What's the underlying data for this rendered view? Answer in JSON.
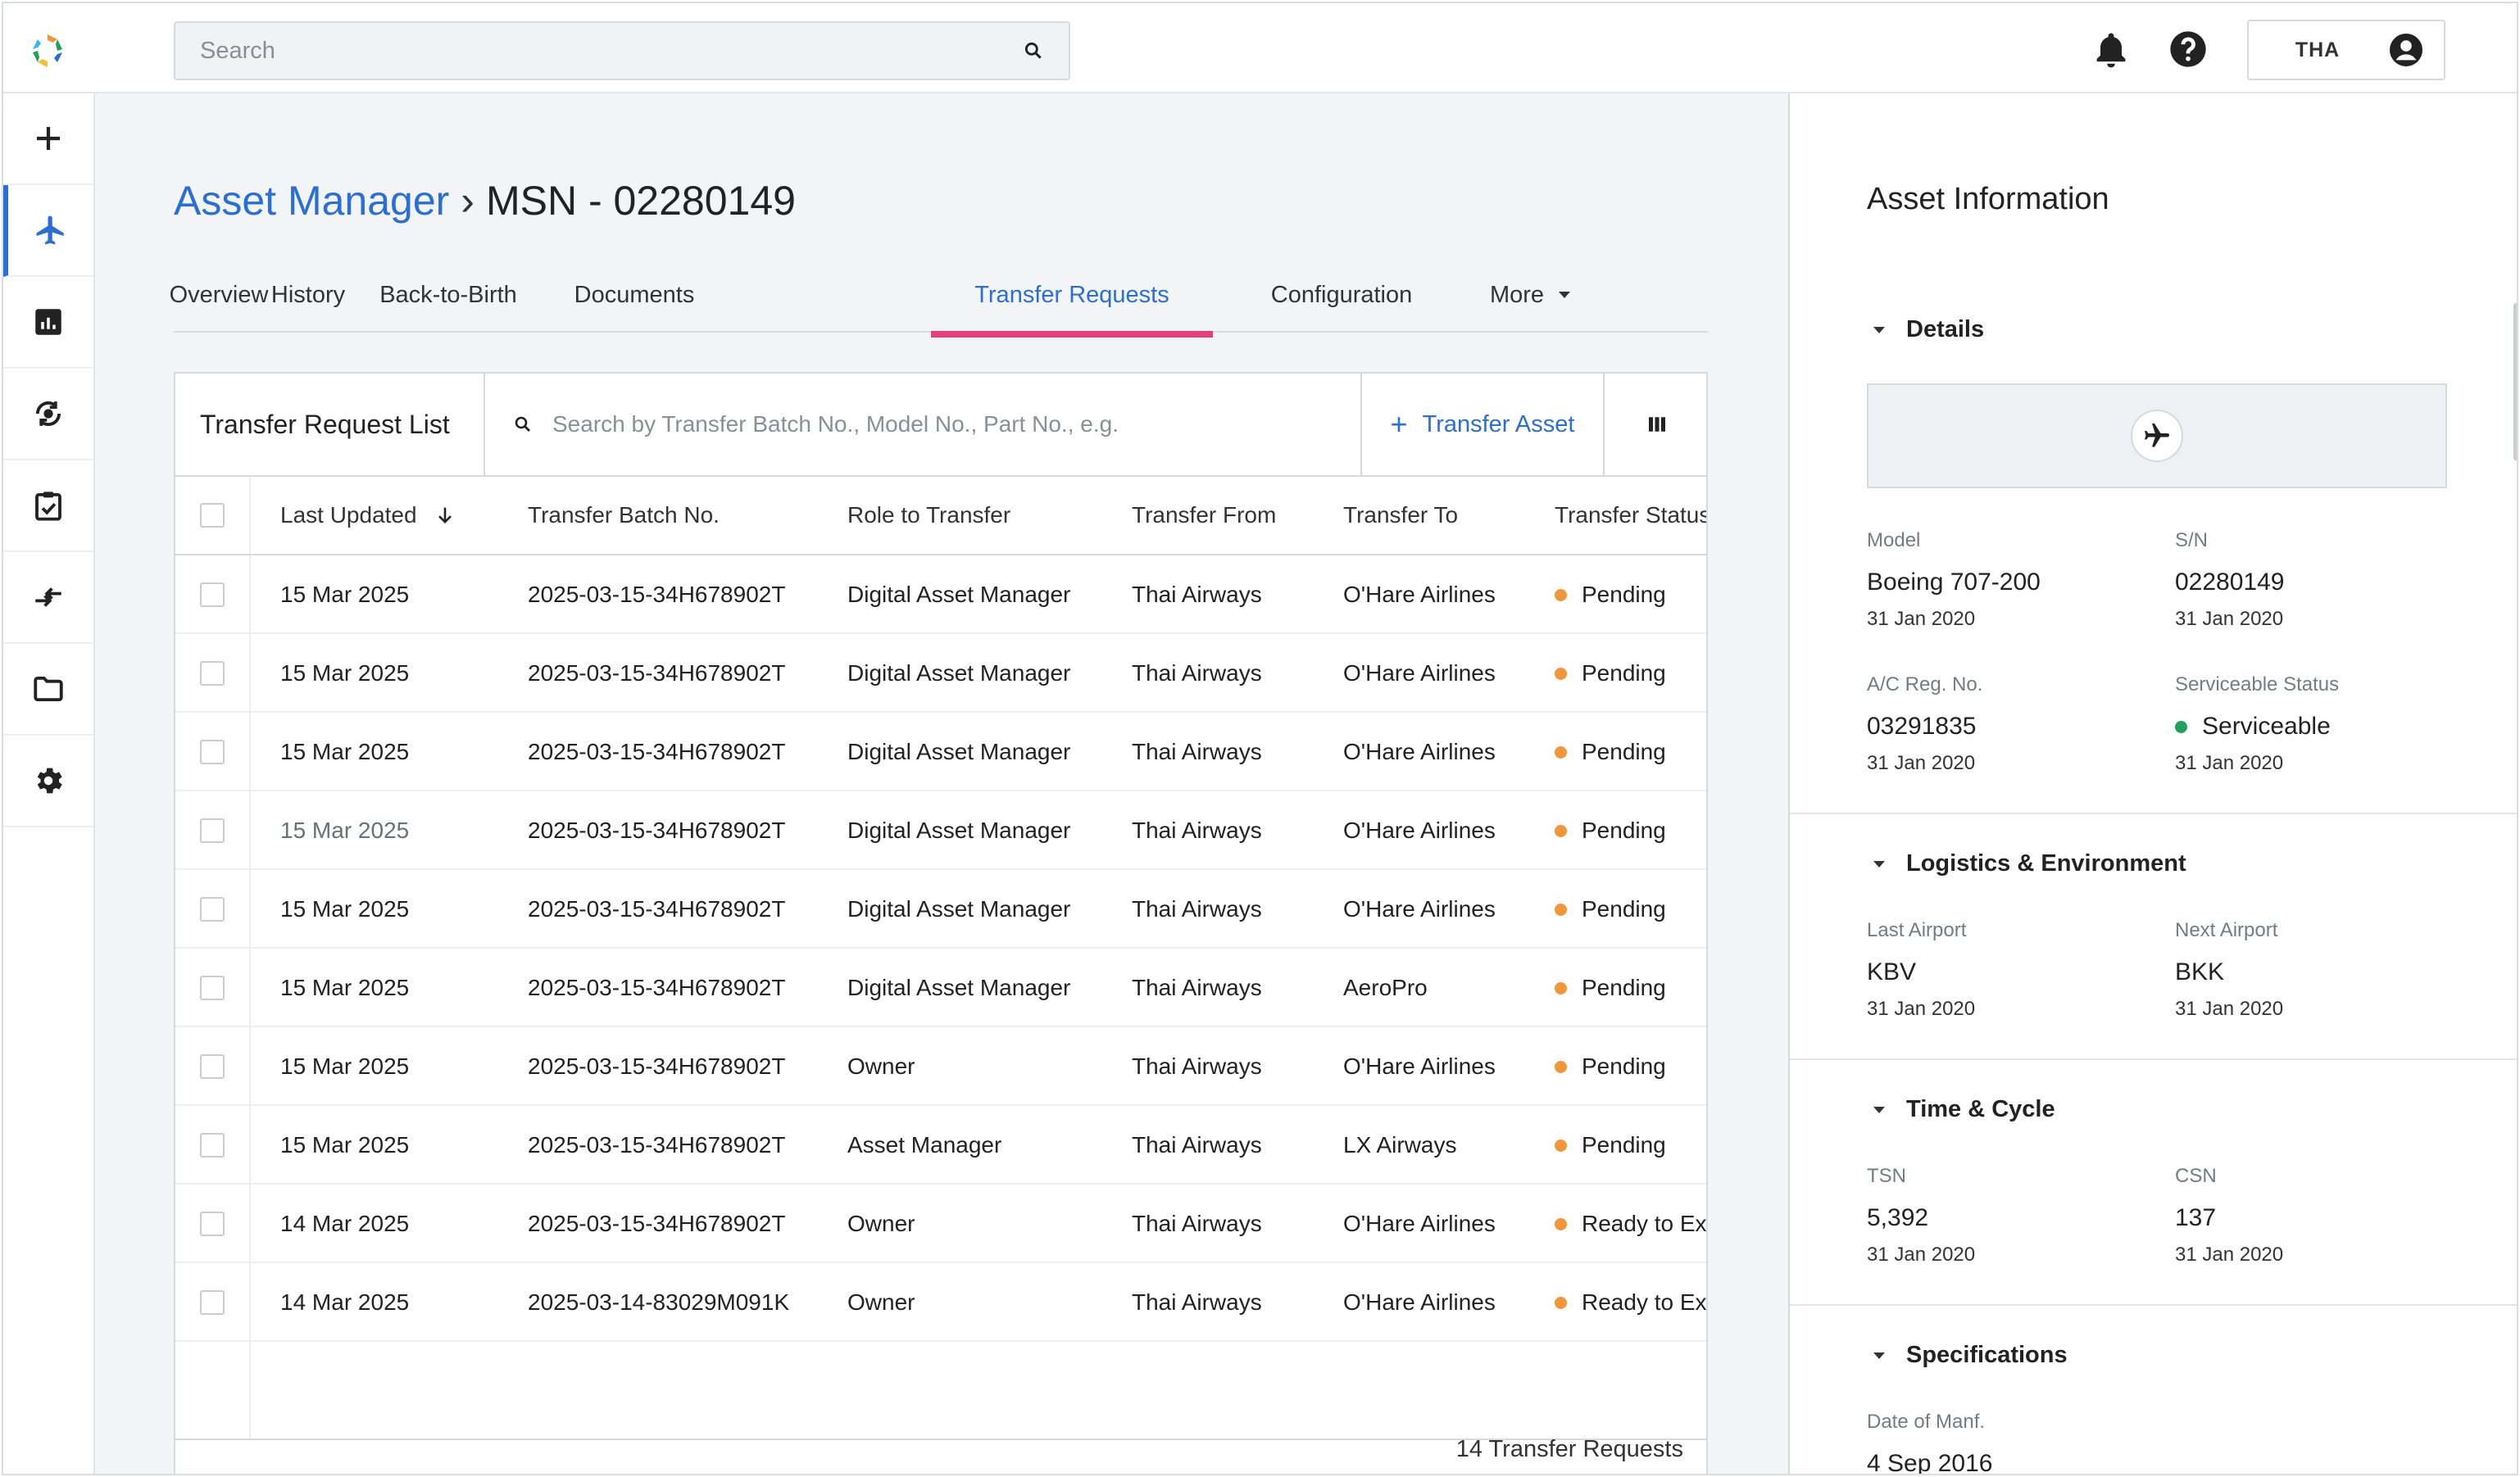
{
  "header": {
    "search_placeholder": "Search",
    "user_code": "THA",
    "icons": [
      "app-logo",
      "search-icon",
      "bell-icon",
      "help-icon",
      "account-icon"
    ]
  },
  "leftnav": {
    "items": [
      {
        "name": "add",
        "icon": "plus-icon"
      },
      {
        "name": "assets",
        "icon": "airplane-icon",
        "active": true
      },
      {
        "name": "reports",
        "icon": "bar-chart-icon"
      },
      {
        "name": "sync",
        "icon": "sync-icon"
      },
      {
        "name": "tasks",
        "icon": "clipboard-check-icon"
      },
      {
        "name": "transfers",
        "icon": "transfer-arrows-icon"
      },
      {
        "name": "folders",
        "icon": "folder-icon"
      },
      {
        "name": "settings",
        "icon": "gear-icon"
      }
    ]
  },
  "breadcrumb": {
    "root": "Asset Manager",
    "separator": "›",
    "current": "MSN - 02280149"
  },
  "tabs": [
    {
      "label": "Overview"
    },
    {
      "label": "History"
    },
    {
      "label": "Back-to-Birth"
    },
    {
      "label": "Documents"
    },
    {
      "label": "Transfer Requests",
      "active": true
    },
    {
      "label": "Configuration"
    },
    {
      "label": "More"
    }
  ],
  "transfer_list": {
    "title": "Transfer Request List",
    "search_placeholder": "Search by Transfer Batch No., Model No., Part No., e.g.",
    "transfer_button": "Transfer Asset",
    "columns": [
      "Last Updated",
      "Transfer Batch No.",
      "Role to Transfer",
      "Transfer From",
      "Transfer To",
      "Transfer Status"
    ],
    "rows": [
      [
        "15 Mar 2025",
        "2025-03-15-34H678902T",
        "Digital Asset Manager",
        "Thai Airways",
        "O'Hare Airlines",
        "Pending"
      ],
      [
        "15 Mar 2025",
        "2025-03-15-34H678902T",
        "Digital Asset Manager",
        "Thai Airways",
        "O'Hare Airlines",
        "Pending"
      ],
      [
        "15 Mar 2025",
        "2025-03-15-34H678902T",
        "Digital Asset Manager",
        "Thai Airways",
        "O'Hare Airlines",
        "Pending"
      ],
      [
        "15 Mar 2025",
        "2025-03-15-34H678902T",
        "Digital Asset Manager",
        "Thai Airways",
        "O'Hare Airlines",
        "Pending"
      ],
      [
        "15 Mar 2025",
        "2025-03-15-34H678902T",
        "Digital Asset Manager",
        "Thai Airways",
        "O'Hare Airlines",
        "Pending"
      ],
      [
        "15 Mar 2025",
        "2025-03-15-34H678902T",
        "Digital Asset Manager",
        "Thai Airways",
        "AeroPro",
        "Pending"
      ],
      [
        "15 Mar 2025",
        "2025-03-15-34H678902T",
        "Owner",
        "Thai Airways",
        "O'Hare Airlines",
        "Pending"
      ],
      [
        "15 Mar 2025",
        "2025-03-15-34H678902T",
        "Asset Manager",
        "Thai Airways",
        "LX Airways",
        "Pending"
      ],
      [
        "14 Mar 2025",
        "2025-03-15-34H678902T",
        "Owner",
        "Thai Airways",
        "O'Hare Airlines",
        "Ready to Execute"
      ],
      [
        "14 Mar 2025",
        "2025-03-14-83029M091K",
        "Owner",
        "Thai Airways",
        "O'Hare Airlines",
        "Ready to Execute"
      ]
    ],
    "status_color": "#f3963a",
    "count_label": "14 Transfer Requests"
  },
  "asset_info": {
    "title": "Asset Information",
    "details": {
      "heading": "Details",
      "model_label": "Model",
      "model_value": "Boeing 707-200",
      "model_date": "31 Jan 2020",
      "sn_label": "S/N",
      "sn_value": "02280149",
      "sn_date": "31 Jan 2020",
      "reg_label": "A/C Reg. No.",
      "reg_value": "03291835",
      "reg_date": "31 Jan 2020",
      "status_label": "Serviceable Status",
      "status_value": "Serviceable",
      "status_date": "31 Jan 2020",
      "status_color": "#1fa15a"
    },
    "logistics": {
      "heading": "Logistics & Environment",
      "last_label": "Last Airport",
      "last_value": "KBV",
      "last_date": "31 Jan 2020",
      "next_label": "Next Airport",
      "next_value": "BKK",
      "next_date": "31 Jan 2020"
    },
    "time_cycle": {
      "heading": "Time & Cycle",
      "tsn_label": "TSN",
      "tsn_value": "5,392",
      "tsn_date": "31 Jan 2020",
      "csn_label": "CSN",
      "csn_value": "137",
      "csn_date": "31 Jan 2020"
    },
    "specifications": {
      "heading": "Specifications",
      "manf_label": "Date of Manf.",
      "manf_value": "4 Sep 2016"
    }
  },
  "colors": {
    "accent": "#2a6fd6",
    "tab_underline": "#e83e7a"
  }
}
